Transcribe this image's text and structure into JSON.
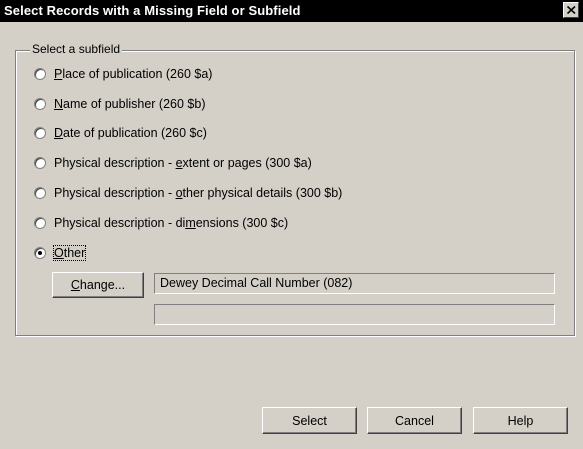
{
  "window": {
    "title": "Select Records with a Missing Field or Subfield"
  },
  "group": {
    "label": "Select a subfield"
  },
  "options": [
    {
      "pre": "",
      "key": "P",
      "post": "lace of publication (260 $a)",
      "checked": false
    },
    {
      "pre": "",
      "key": "N",
      "post": "ame of publisher (260 $b)",
      "checked": false
    },
    {
      "pre": "",
      "key": "D",
      "post": "ate of publication (260 $c)",
      "checked": false
    },
    {
      "pre": "Physical description - ",
      "key": "e",
      "post": "xtent or pages (300 $a)",
      "checked": false
    },
    {
      "pre": "Physical description - ",
      "key": "o",
      "post": "ther physical details (300 $b)",
      "checked": false
    },
    {
      "pre": "Physical description - di",
      "key": "m",
      "post": "ensions (300 $c)",
      "checked": false
    },
    {
      "pre": "",
      "key": "O",
      "post": "ther",
      "checked": true
    }
  ],
  "change_button": {
    "key": "C",
    "post": "hange..."
  },
  "other_field": {
    "value": "Dewey Decimal Call Number (082)"
  },
  "second_field": {
    "value": ""
  },
  "buttons": {
    "select": "Select",
    "cancel": "Cancel",
    "help": "Help"
  }
}
